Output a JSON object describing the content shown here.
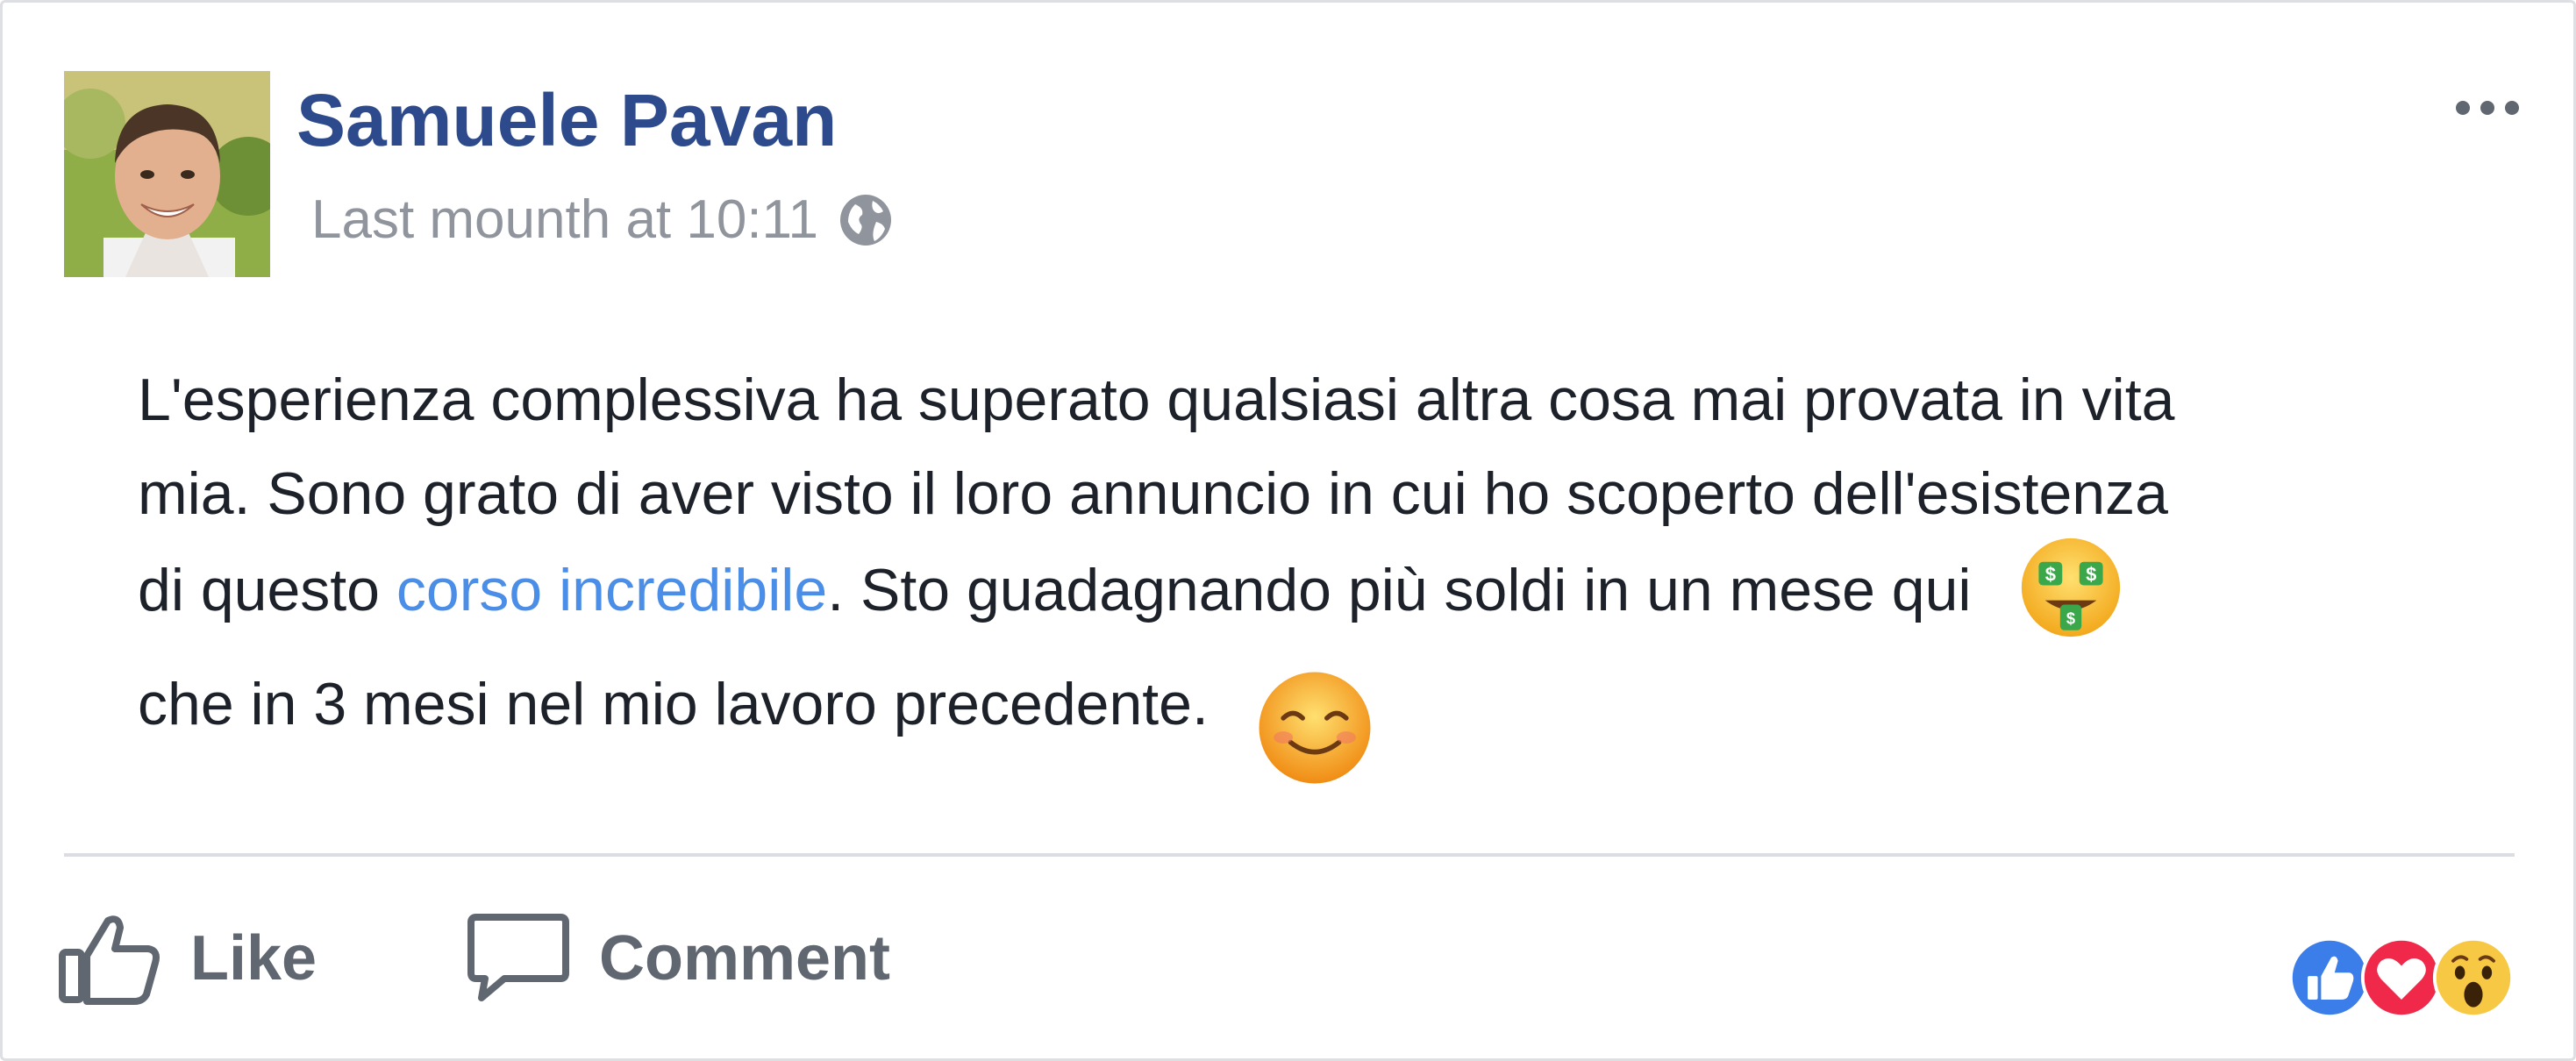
{
  "post": {
    "author": "Samuele Pavan",
    "timestamp": "Last mounth at 10:11",
    "privacy_icon": "globe-icon",
    "menu_icon": "more-options-icon",
    "text_lines": [
      "L'esperienza complessiva ha superato qualsiasi altra cosa mai provata in vita",
      "mia. Sono grato di aver visto il loro annuncio in cui ho scoperto dell'esistenza"
    ],
    "line3_before_link": "di questo ",
    "link_text": "corso incredibile",
    "line3_after_link": ". Sto guadagnando più soldi in un mese qui",
    "line4": "che in 3 mesi nel mio lavoro precedente.",
    "emojis": [
      "money-mouth-face-emoji",
      "smiling-face-emoji"
    ]
  },
  "actions": {
    "like_label": "Like",
    "comment_label": "Comment"
  },
  "reactions": [
    "like-reaction-icon",
    "love-reaction-icon",
    "wow-reaction-icon"
  ],
  "colors": {
    "author": "#2d4a8c",
    "link": "#4a8ee8",
    "meta": "#90949c",
    "text": "#1d2129",
    "action": "#606770",
    "like_blue": "#3b7de9",
    "love_red": "#f0284a",
    "wow_yellow": "#f7c844"
  }
}
